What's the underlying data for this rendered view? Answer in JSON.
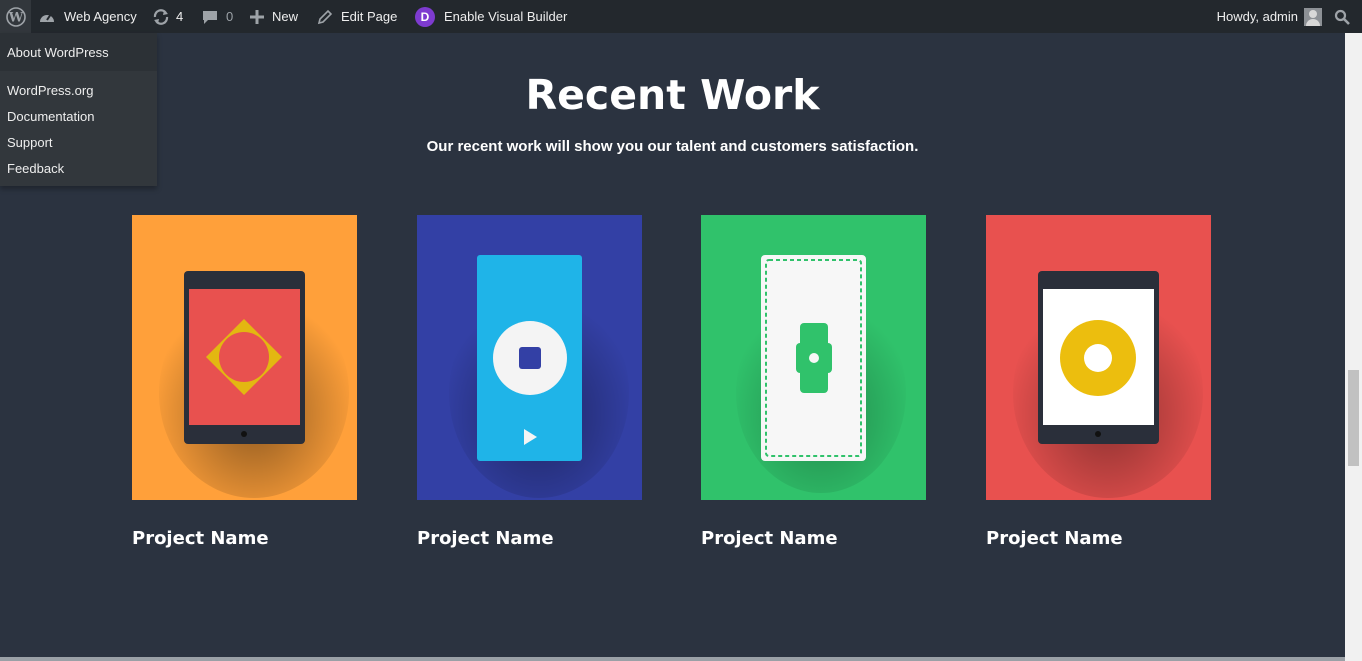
{
  "adminbar": {
    "wp_icon": "wordpress-logo-icon",
    "site_name": "Web Agency",
    "updates_count": "4",
    "comments_count": "0",
    "new_label": "New",
    "edit_label": "Edit Page",
    "divi_letter": "D",
    "visual_builder_label": "Enable Visual Builder",
    "howdy": "Howdy, admin"
  },
  "wp_menu": {
    "about": "About WordPress",
    "items": [
      "WordPress.org",
      "Documentation",
      "Support",
      "Feedback"
    ]
  },
  "section": {
    "title": "Recent Work",
    "subtitle": "Our recent work will show you our talent and customers satisfaction."
  },
  "projects": [
    {
      "name": "Project Name",
      "color": "#ffa03a",
      "illustration": "tablet-diamond"
    },
    {
      "name": "Project Name",
      "color": "#3340a5",
      "illustration": "phone-player"
    },
    {
      "name": "Project Name",
      "color": "#30c26b",
      "illustration": "smartwatch"
    },
    {
      "name": "Project Name",
      "color": "#e8514f",
      "illustration": "tablet-donut"
    }
  ]
}
